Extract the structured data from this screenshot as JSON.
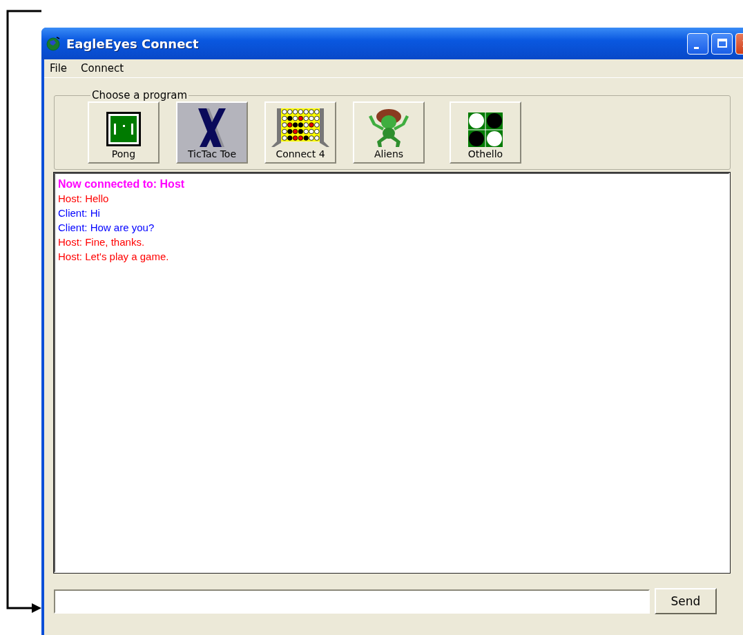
{
  "window": {
    "title": "EagleEyes Connect"
  },
  "menu": [
    "File",
    "Connect"
  ],
  "program_group": {
    "label": "Choose a program",
    "programs": [
      {
        "kind": "pong",
        "label": "Pong"
      },
      {
        "kind": "tictactoe",
        "label": "TicTac Toe"
      },
      {
        "kind": "connect4",
        "label": "Connect 4"
      },
      {
        "kind": "aliens",
        "label": "Aliens"
      },
      {
        "kind": "othello",
        "label": "Othello"
      }
    ]
  },
  "chat": [
    {
      "kind": "status",
      "text": "Now connected to: Host"
    },
    {
      "kind": "host",
      "text": "Host: Hello"
    },
    {
      "kind": "client",
      "text": "Client: Hi"
    },
    {
      "kind": "client",
      "text": "Client: How are you?"
    },
    {
      "kind": "host",
      "text": "Host: Fine, thanks."
    },
    {
      "kind": "host",
      "text": "Host: Let's play a game."
    }
  ],
  "send_button": "Send"
}
